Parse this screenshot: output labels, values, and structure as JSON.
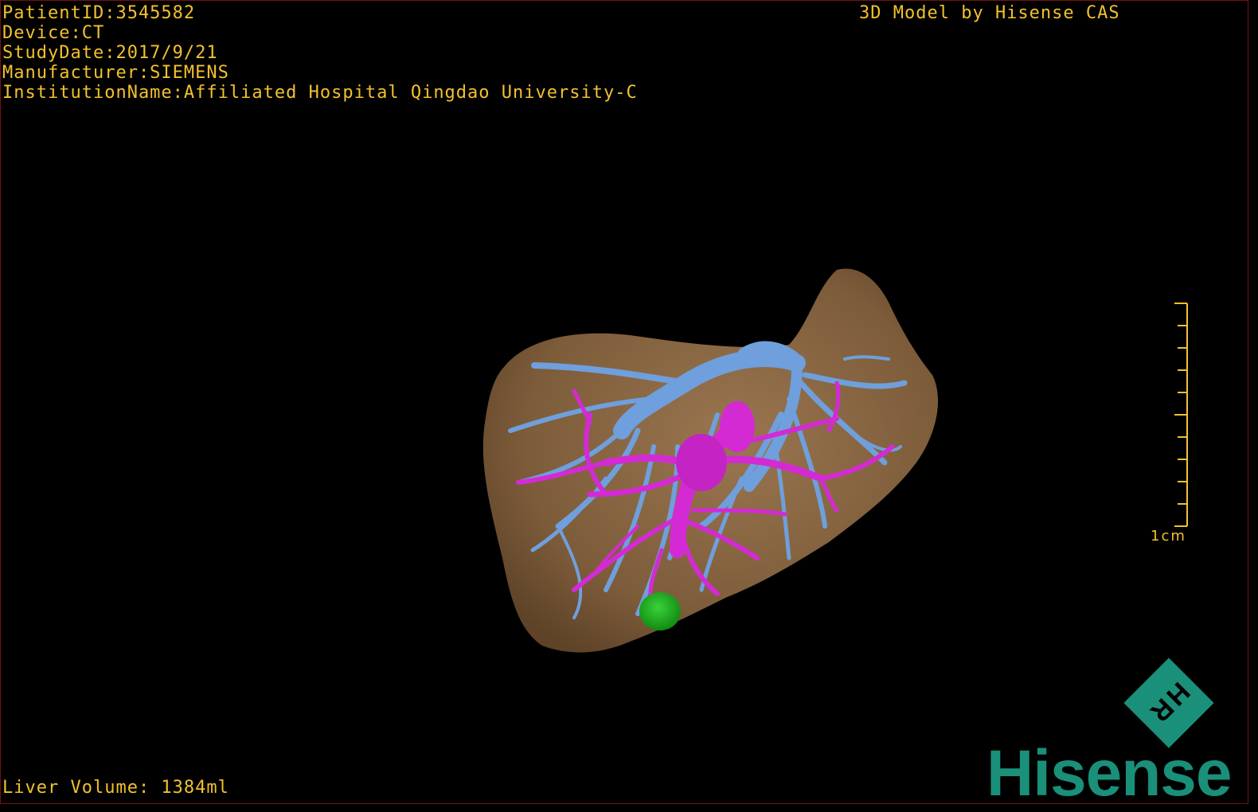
{
  "info": {
    "patient_id": "PatientID:3545582",
    "device": "Device:CT",
    "study_date": "StudyDate:2017/9/21",
    "manufacturer": "Manufacturer:SIEMENS",
    "institution": "InstitutionName:Affiliated Hospital Qingdao University-C"
  },
  "credit": "3D Model by Hisense CAS",
  "liver_volume": "Liver Volume: 1384ml",
  "scale_bar": {
    "label": "1cm"
  },
  "logo": {
    "brand": "Hisense",
    "mark": "HR",
    "color": "#1a8f79"
  },
  "colors": {
    "overlay_text": "#f2c12e",
    "liver": "#8a6640",
    "portal_vein": "#6f9fdc",
    "hepatic_vein": "#d42ad4",
    "tumor": "#22b022"
  },
  "icons": [
    "scale-bar",
    "hisense-logo-icon"
  ]
}
